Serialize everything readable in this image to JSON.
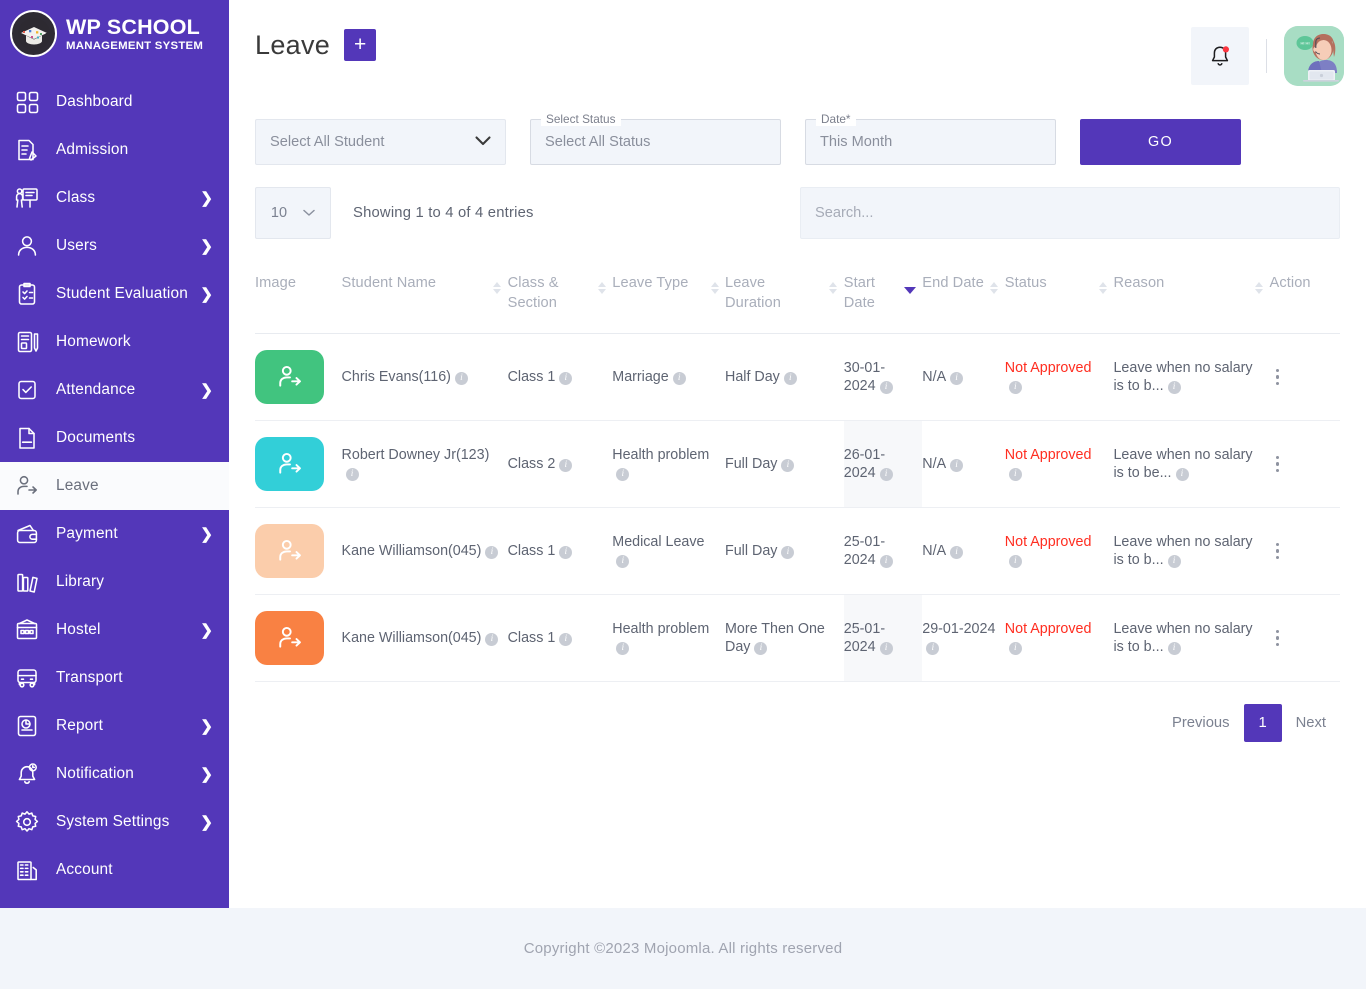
{
  "brand": {
    "title": "WP SCHOOL",
    "subtitle": "MANAGEMENT SYSTEM",
    "logo_icon": "graduation-cap-icon"
  },
  "colors": {
    "sidebar_bg": "#5337b9",
    "accent": "#5337b9",
    "danger": "#ff2d20",
    "field_bg": "#f2f5fa",
    "footer_bg": "#f2f5fa"
  },
  "sidebar": {
    "items": [
      {
        "label": "Dashboard",
        "icon": "grid-dashboard-icon",
        "has_children": false,
        "active": false
      },
      {
        "label": "Admission",
        "icon": "document-pencil-icon",
        "has_children": false,
        "active": false
      },
      {
        "label": "Class",
        "icon": "teacher-board-icon",
        "has_children": true,
        "active": false
      },
      {
        "label": "Users",
        "icon": "user-icon",
        "has_children": true,
        "active": false
      },
      {
        "label": "Student Evaluation",
        "icon": "clipboard-check-icon",
        "has_children": true,
        "active": false
      },
      {
        "label": "Homework",
        "icon": "book-pen-icon",
        "has_children": false,
        "active": false
      },
      {
        "label": "Attendance",
        "icon": "clipboard-tick-icon",
        "has_children": true,
        "active": false
      },
      {
        "label": "Documents",
        "icon": "doc-file-icon",
        "has_children": false,
        "active": false
      },
      {
        "label": "Leave",
        "icon": "person-exit-icon",
        "has_children": false,
        "active": true
      },
      {
        "label": "Payment",
        "icon": "wallet-icon",
        "has_children": true,
        "active": false
      },
      {
        "label": "Library",
        "icon": "books-icon",
        "has_children": false,
        "active": false
      },
      {
        "label": "Hostel",
        "icon": "building-icon",
        "has_children": true,
        "active": false
      },
      {
        "label": "Transport",
        "icon": "bus-icon",
        "has_children": false,
        "active": false
      },
      {
        "label": "Report",
        "icon": "report-chart-icon",
        "has_children": true,
        "active": false
      },
      {
        "label": "Notification",
        "icon": "bell-clock-icon",
        "has_children": true,
        "active": false
      },
      {
        "label": "System Settings",
        "icon": "gear-icon",
        "has_children": true,
        "active": false
      },
      {
        "label": "Account",
        "icon": "bank-building-icon",
        "has_children": false,
        "active": false
      }
    ],
    "chevron": "❯"
  },
  "topbar": {
    "title": "Leave",
    "add_label": "+",
    "bell_icon": "bell-icon",
    "has_notification_dot": true,
    "avatar_icon": "support-agent-avatar"
  },
  "filters": {
    "student": {
      "value": "Select All Student",
      "arrow": "chevron-down-icon"
    },
    "status": {
      "legend": "Select Status",
      "value": "Select All Status"
    },
    "date": {
      "legend": "Date*",
      "value": "This Month"
    },
    "go_label": "GO"
  },
  "toolbar": {
    "page_length": "10",
    "length_arrow": "⌄",
    "showing": "Showing 1 to 4 of 4 entries",
    "search_placeholder": "Search...",
    "search_value": ""
  },
  "table": {
    "columns": [
      {
        "label": "Image",
        "sortable": false,
        "sort": "none"
      },
      {
        "label": "Student Name",
        "sortable": true,
        "sort": "none"
      },
      {
        "label": "Class & Section",
        "sortable": true,
        "sort": "none"
      },
      {
        "label": "Leave Type",
        "sortable": true,
        "sort": "none"
      },
      {
        "label": "Leave Duration",
        "sortable": true,
        "sort": "none"
      },
      {
        "label": "Start Date",
        "sortable": true,
        "sort": "desc"
      },
      {
        "label": "End Date",
        "sortable": true,
        "sort": "none"
      },
      {
        "label": "Status",
        "sortable": true,
        "sort": "none"
      },
      {
        "label": "Reason",
        "sortable": true,
        "sort": "none"
      },
      {
        "label": "Action",
        "sortable": false,
        "sort": "none"
      }
    ],
    "rows": [
      {
        "avatar_color": "#41c47f",
        "student_name": "Chris Evans(116)",
        "class_section": "Class 1",
        "leave_type": "Marriage",
        "leave_duration": "Half Day",
        "start_date": "30-01-2024",
        "end_date": "N/A",
        "status": "Not Approved",
        "reason": "Leave when no salary is to b..."
      },
      {
        "avatar_color": "#32cfd8",
        "student_name": "Robert Downey Jr(123)",
        "class_section": "Class 2",
        "leave_type": "Health problem",
        "leave_duration": "Full Day",
        "start_date": "26-01-2024",
        "end_date": "N/A",
        "status": "Not Approved",
        "reason": "Leave when no salary is to be..."
      },
      {
        "avatar_color": "#fbcdab",
        "student_name": "Kane Williamson(045)",
        "class_section": "Class 1",
        "leave_type": "Medical Leave",
        "leave_duration": "Full Day",
        "start_date": "25-01-2024",
        "end_date": "N/A",
        "status": "Not Approved",
        "reason": "Leave when no salary is to b..."
      },
      {
        "avatar_color": "#f98143",
        "student_name": "Kane Williamson(045)",
        "class_section": "Class 1",
        "leave_type": "Health problem",
        "leave_duration": "More Then One Day",
        "start_date": "25-01-2024",
        "end_date": "29-01-2024",
        "status": "Not Approved",
        "reason": "Leave when no salary is to b..."
      }
    ],
    "info_tooltip_icon": "info-icon",
    "action_icon": "vertical-dots-icon"
  },
  "pagination": {
    "previous": "Previous",
    "pages": [
      "1"
    ],
    "current": "1",
    "next": "Next"
  },
  "footer": {
    "text": "Copyright ©2023 Mojoomla. All rights reserved"
  }
}
